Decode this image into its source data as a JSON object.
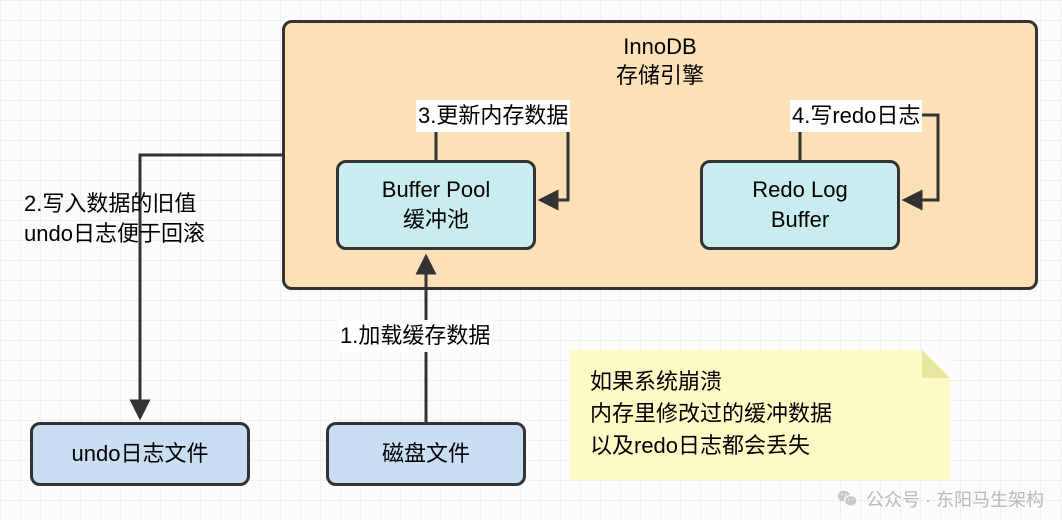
{
  "innodb": {
    "title_line1": "InnoDB",
    "title_line2": "存储引擎",
    "buffer_pool_line1": "Buffer Pool",
    "buffer_pool_line2": "缓冲池",
    "redo_buffer_line1": "Redo Log",
    "redo_buffer_line2": "Buffer"
  },
  "files": {
    "undo": "undo日志文件",
    "disk": "磁盘文件"
  },
  "labels": {
    "step1": "1.加载缓存数据",
    "step2_line1": "2.写入数据的旧值",
    "step2_line2": "undo日志便于回滚",
    "step3": "3.更新内存数据",
    "step4": "4.写redo日志"
  },
  "note": {
    "line1": "如果系统崩溃",
    "line2": "内存里修改过的缓冲数据",
    "line3": "以及redo日志都会丢失"
  },
  "watermark": {
    "text": "公众号 · 东阳马生架构"
  }
}
